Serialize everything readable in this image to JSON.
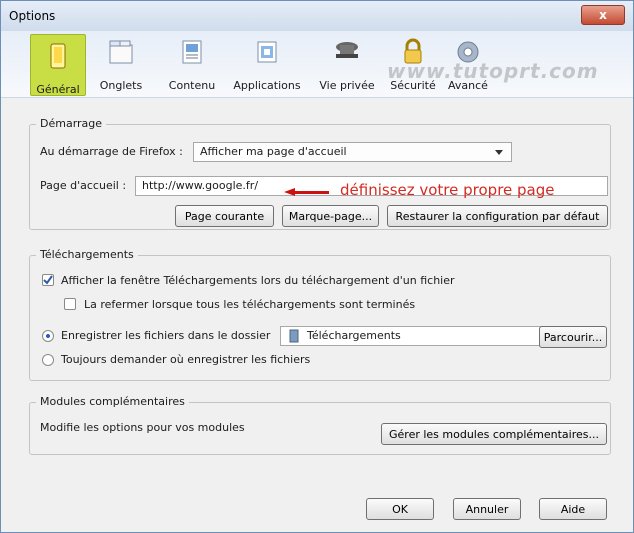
{
  "window": {
    "title": "Options",
    "close_glyph": "x"
  },
  "watermark": "www.tutoprt.com",
  "toolbar": {
    "items": [
      {
        "label": "Général",
        "icon": "general-icon"
      },
      {
        "label": "Onglets",
        "icon": "tabs-icon"
      },
      {
        "label": "Contenu",
        "icon": "content-icon"
      },
      {
        "label": "Applications",
        "icon": "applications-icon"
      },
      {
        "label": "Vie privée",
        "icon": "privacy-icon"
      },
      {
        "label": "Sécurité",
        "icon": "lock-icon"
      },
      {
        "label": "Avancé",
        "icon": "gear-icon"
      }
    ]
  },
  "startup": {
    "legend": "Démarrage",
    "firefox_label": "Au démarrage de Firefox :",
    "firefox_value": "Afficher ma page d'accueil",
    "homepage_label": "Page d'accueil :",
    "homepage_value": "http://www.google.fr/",
    "annotation": "définissez votre propre page",
    "current_page": "Page courante",
    "bookmark": "Marque-page...",
    "restore_default": "Restaurer la configuration par défaut"
  },
  "downloads": {
    "legend": "Téléchargements",
    "show_window": "Afficher la fenêtre Téléchargements lors du téléchargement d'un fichier",
    "close_when_done": "La refermer lorsque tous les téléchargements sont terminés",
    "save_to": "Enregistrer les fichiers dans le dossier",
    "folder": "Téléchargements",
    "browse": "Parcourir...",
    "always_ask": "Toujours demander où enregistrer les fichiers"
  },
  "addons": {
    "legend": "Modules complémentaires",
    "description": "Modifie les options pour vos modules",
    "manage": "Gérer les modules complémentaires..."
  },
  "footer": {
    "ok": "OK",
    "cancel": "Annuler",
    "help": "Aide"
  },
  "colors": {
    "selected_tab": "#c9dd45",
    "annotation": "#d42a22",
    "radio": "#2b5bc8"
  }
}
